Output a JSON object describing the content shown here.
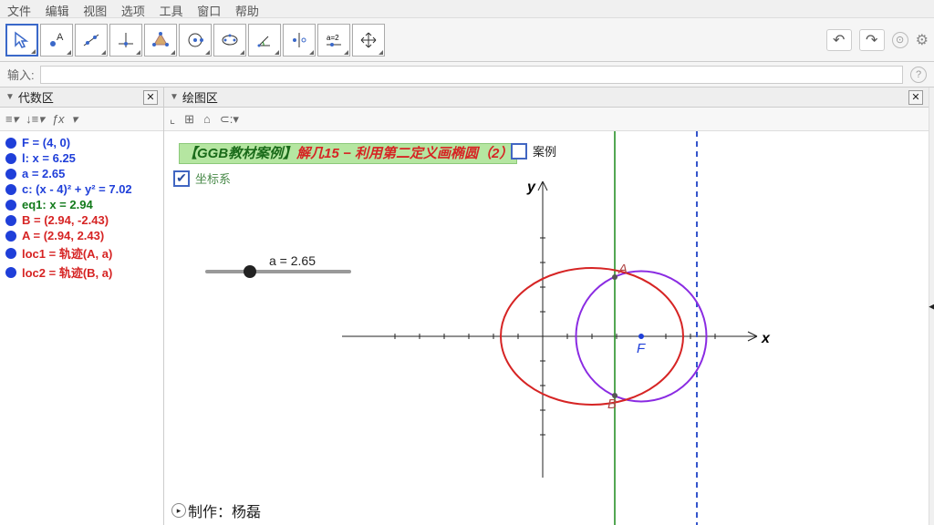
{
  "menubar": [
    "文件",
    "编辑",
    "视图",
    "选项",
    "工具",
    "窗口",
    "帮助"
  ],
  "input_label": "输入:",
  "panels": {
    "algebra": "代数区",
    "graphics": "绘图区"
  },
  "algebra_toolbar": {
    "fx": "ƒx"
  },
  "algebra_items": [
    {
      "color": "#1f3fd9",
      "text": "F = (4, 0)"
    },
    {
      "color": "#1f3fd9",
      "text": "l: x = 6.25"
    },
    {
      "color": "#1f3fd9",
      "text": "a = 2.65"
    },
    {
      "color": "#1f3fd9",
      "text": "c: (x - 4)² + y² = 7.02"
    },
    {
      "color": "#127a1b",
      "text": "eq1: x = 2.94"
    },
    {
      "color": "#d62424",
      "text": "B = (2.94, -2.43)"
    },
    {
      "color": "#d62424",
      "text": "A = (2.94, 2.43)"
    },
    {
      "color": "#d62424",
      "text": "loc1 = 轨迹(A, a)"
    },
    {
      "color": "#d62424",
      "text": "loc2 = 轨迹(B, a)"
    }
  ],
  "canvas": {
    "title_prefix": "【GGB教材案例】",
    "title_main": "解几15 − 利用第二定义画椭圆（2）",
    "case_label": "案例",
    "coord_label": "坐标系",
    "slider_label": "a = 2.65",
    "author_label": "制作：杨磊",
    "axis_x": "x",
    "axis_y": "y",
    "point_F": "F",
    "point_A": "A",
    "point_B": "B"
  },
  "chart_data": {
    "type": "geometry",
    "title": "解几15 − 利用第二定义画椭圆（2）",
    "x_range": [
      -5,
      10
    ],
    "y_range": [
      -6,
      6
    ],
    "slider": {
      "name": "a",
      "value": 2.65
    },
    "objects": {
      "F": {
        "type": "point",
        "x": 4,
        "y": 0,
        "color": "#1f3fd9"
      },
      "l": {
        "type": "vline",
        "x": 6.25,
        "style": "dashed",
        "color": "#3555cc"
      },
      "eq1": {
        "type": "vline",
        "x": 2.94,
        "style": "solid",
        "color": "#1a8a1a"
      },
      "c": {
        "type": "circle",
        "cx": 4,
        "cy": 0,
        "r": 2.65,
        "color": "#8a2be2"
      },
      "A": {
        "type": "point",
        "x": 2.94,
        "y": 2.43,
        "color": "#d62424"
      },
      "B": {
        "type": "point",
        "x": 2.94,
        "y": -2.43,
        "color": "#d62424"
      },
      "loc": {
        "type": "ellipse",
        "cx": 2,
        "cy": 0,
        "rx": 3.7,
        "ry": 2.8,
        "color": "#d62424"
      }
    }
  }
}
